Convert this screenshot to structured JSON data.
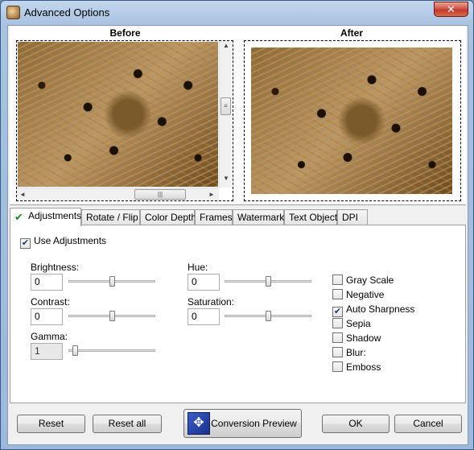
{
  "window": {
    "title": "Advanced Options",
    "close_glyph": "✕"
  },
  "preview": {
    "before_label": "Before",
    "after_label": "After",
    "scroll_grip": "|||",
    "arrows": {
      "up": "▲",
      "down": "▼",
      "left": "◄",
      "right": "►"
    }
  },
  "tabs": [
    {
      "label": "Adjustments",
      "active": true
    },
    {
      "label": "Rotate / Flip"
    },
    {
      "label": "Color Depth"
    },
    {
      "label": "Frames"
    },
    {
      "label": "Watermark"
    },
    {
      "label": "Text Object"
    },
    {
      "label": "DPI"
    }
  ],
  "adjustments": {
    "use_adjustments": {
      "label": "Use Adjustments",
      "checked": true
    },
    "brightness": {
      "label": "Brightness:",
      "value": "0",
      "level": 0.5
    },
    "contrast": {
      "label": "Contrast:",
      "value": "0",
      "level": 0.5
    },
    "gamma": {
      "label": "Gamma:",
      "value": "1",
      "level": 0.05
    },
    "hue": {
      "label": "Hue:",
      "value": "0",
      "level": 0.5
    },
    "saturation": {
      "label": "Saturation:",
      "value": "0",
      "level": 0.5
    },
    "options": [
      {
        "label": "Gray Scale",
        "checked": false
      },
      {
        "label": "Negative",
        "checked": false
      },
      {
        "label": "Auto Sharpness",
        "checked": true
      },
      {
        "label": "Sepia",
        "checked": false
      },
      {
        "label": "Shadow",
        "checked": false
      },
      {
        "label": "Blur:",
        "checked": false
      },
      {
        "label": "Emboss",
        "checked": false
      }
    ],
    "check_glyph": "✔"
  },
  "buttons": {
    "reset": "Reset",
    "reset_all": "Reset all",
    "conversion_preview": "Conversion Preview",
    "ok": "OK",
    "cancel": "Cancel"
  },
  "icons": {
    "app": "app-icon",
    "conversion_preview": "conversion-preview-icon",
    "conversion_glyph": "✥"
  }
}
